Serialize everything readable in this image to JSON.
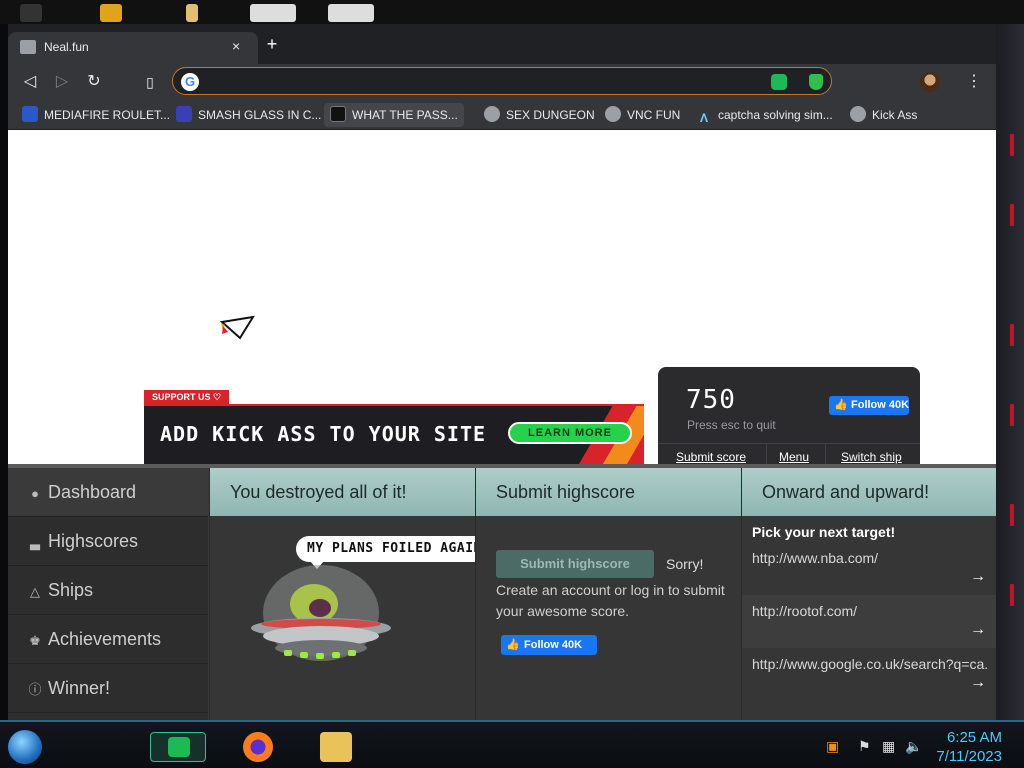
{
  "browser": {
    "tab_title": "Neal.fun",
    "tab_close": "×",
    "new_tab": "+",
    "address_value": "",
    "bookmarks": [
      {
        "label": "MEDIAFIRE ROULET...",
        "icon": "mediafire-icon",
        "color": "#2a58c9"
      },
      {
        "label": "SMASH GLASS IN C...",
        "icon": "smash-glass-icon",
        "color": "#3a3fb5"
      },
      {
        "label": "WHAT THE PASS...",
        "icon": "password-game-icon",
        "color": "#2b2b2b"
      },
      {
        "label": "SEX DUNGEON",
        "icon": "gear-icon",
        "color": "#9aa0a6"
      },
      {
        "label": "VNC FUN",
        "icon": "gear-icon",
        "color": "#9aa0a6"
      },
      {
        "label": "captcha solving sim...",
        "icon": "captcha-icon",
        "color": "#35363a"
      },
      {
        "label": "Kick Ass",
        "icon": "globe-icon",
        "color": "#9aa0a6"
      }
    ]
  },
  "game": {
    "support_tag": "SUPPORT US ♡",
    "banner_text": "ADD KICK ASS TO YOUR SITE",
    "banner_button": "LEARN MORE",
    "score": "750",
    "esc_hint": "Press esc to quit",
    "follow_label": "Follow 40K",
    "links": [
      "Submit score",
      "Menu",
      "Switch ship"
    ]
  },
  "dashboard": {
    "sidebar": [
      {
        "label": "Dashboard",
        "icon": "user-icon",
        "glyph": "●"
      },
      {
        "label": "Highscores",
        "icon": "podium-icon",
        "glyph": "▃"
      },
      {
        "label": "Ships",
        "icon": "ship-icon",
        "glyph": "△"
      },
      {
        "label": "Achievements",
        "icon": "trophy-icon",
        "glyph": "♚"
      },
      {
        "label": "Winner!",
        "icon": "info-icon",
        "glyph": "ⓘ"
      }
    ],
    "col1": {
      "header": "You destroyed all of it!",
      "bubble": "MY PLANS FOILED AGAIN"
    },
    "col2": {
      "header": "Submit highscore",
      "button": "Submit highscore",
      "sorry": "Sorry!",
      "text": "Create an account or log in to submit your awesome score.",
      "follow": "Follow 40K"
    },
    "col3": {
      "header": "Onward and upward!",
      "pick": "Pick your next target!",
      "targets": [
        "http://www.nba.com/",
        "http://rootof.com/",
        "http://www.google.co.uk/search?q=ca..."
      ],
      "arrow": "→"
    }
  },
  "taskbar": {
    "time": "6:25 AM",
    "date": "7/11/2023"
  },
  "colors": {
    "accent_red": "#d8232a",
    "learn_green": "#26d24a",
    "facebook_blue": "#1877f2",
    "header_teal": "#aecdc9",
    "clock_blue": "#49c7ff"
  }
}
